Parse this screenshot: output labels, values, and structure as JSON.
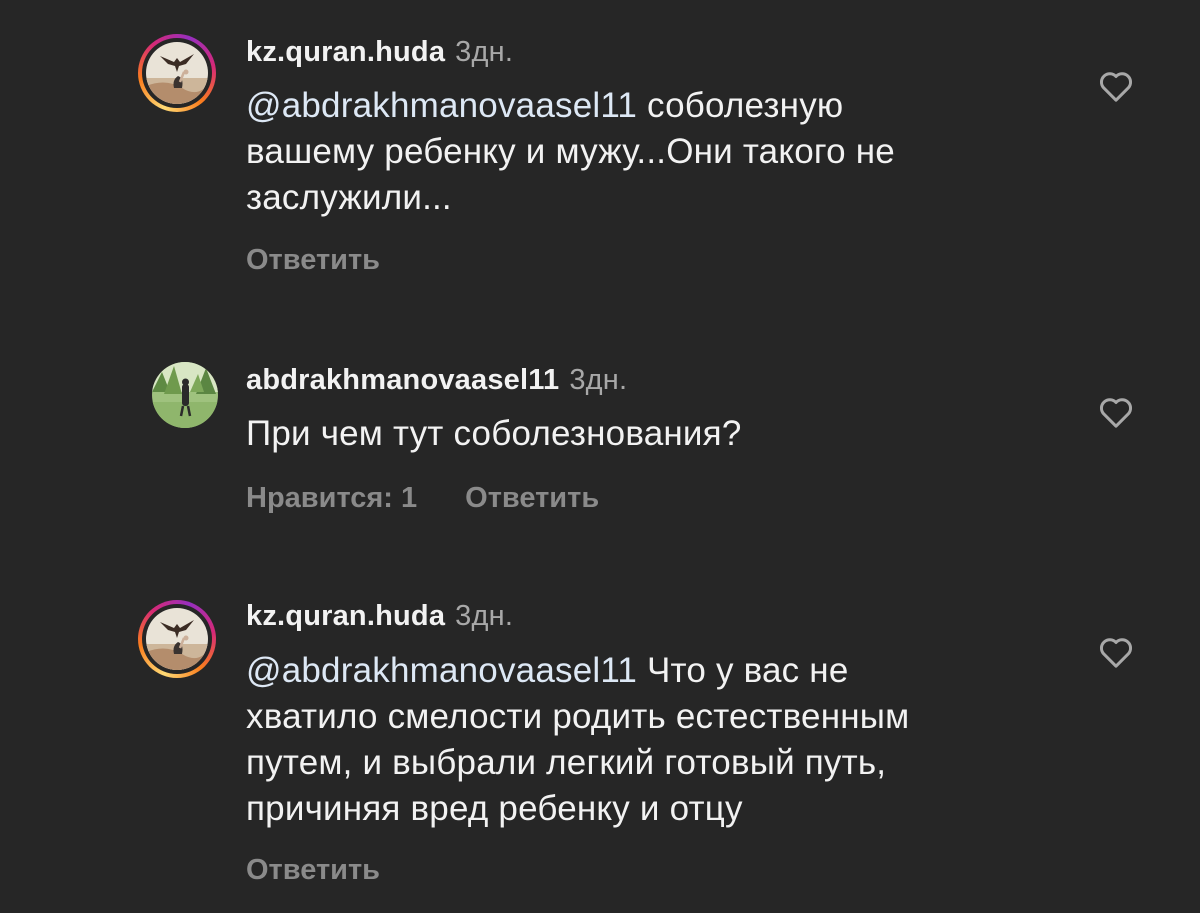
{
  "comments": [
    {
      "username": "kz.quran.huda",
      "time": "3дн.",
      "mention": "@abdrakhmanovaasel11",
      "text_lines": [
        "соболезную",
        "вашему ребенку и мужу...Они такого не",
        "заслужили..."
      ],
      "reply_label": "Ответить",
      "avatar_icon": "eagle-avatar-icon",
      "has_story_ring": true
    },
    {
      "username": "abdrakhmanovaasel11",
      "time": "3дн.",
      "text_lines": [
        "При чем тут соболезнования?"
      ],
      "likes_label": "Нравится: 1",
      "reply_label": "Ответить",
      "avatar_icon": "outdoor-person-avatar-icon",
      "has_story_ring": false
    },
    {
      "username": "kz.quran.huda",
      "time": "3дн.",
      "mention": "@abdrakhmanovaasel11",
      "text_lines": [
        "Что у вас не",
        "хватило смелости родить естественным",
        "путем, и выбрали легкий готовый путь,",
        "причиняя вред ребенку и отцу"
      ],
      "reply_label": "Ответить",
      "avatar_icon": "eagle-avatar-icon",
      "has_story_ring": true
    }
  ],
  "colors": {
    "background": "#262626",
    "primary_text": "#f2f2f2",
    "secondary_text": "#a8a8a8",
    "action_text": "#8a8a8a",
    "mention": "#dde8f5"
  },
  "icons": {
    "like": "heart-outline-icon"
  }
}
